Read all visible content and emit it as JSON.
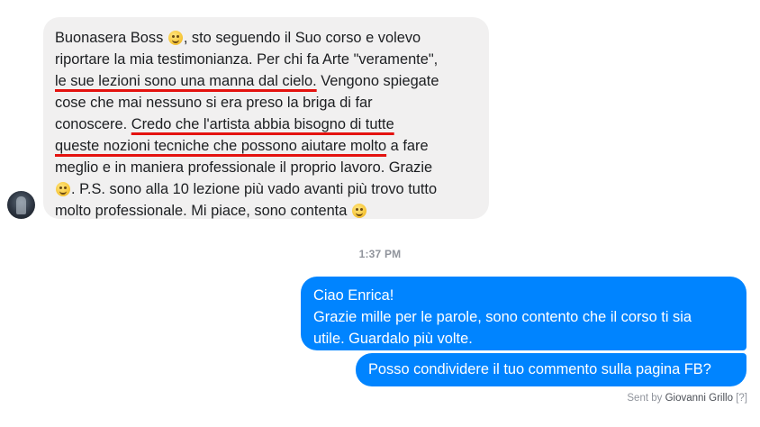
{
  "incoming": {
    "lines": [
      {
        "parts": [
          {
            "text": "Buonasera Boss "
          },
          {
            "emoji": "smiling-face-icon"
          },
          {
            "text": ", sto seguendo il Suo corso e volevo"
          }
        ]
      },
      {
        "parts": [
          {
            "text": "riportare la mia testimonianza. Per chi fa Arte \"veramente\","
          }
        ]
      },
      {
        "parts": [
          {
            "text": "le sue lezioni sono una manna dal cielo.",
            "u": true
          },
          {
            "text": " Vengono spiegate"
          }
        ]
      },
      {
        "parts": [
          {
            "text": "cose che mai nessuno si era preso la briga di far"
          }
        ]
      },
      {
        "parts": [
          {
            "text": "conoscere. "
          },
          {
            "text": "Credo che l'artista abbia bisogno di tutte",
            "u": true
          }
        ]
      },
      {
        "parts": [
          {
            "text": "queste nozioni tecniche che possono aiutare molto",
            "u": true
          },
          {
            "text": " a fare"
          }
        ]
      },
      {
        "parts": [
          {
            "text": "meglio e in maniera professionale il proprio lavoro. Grazie"
          }
        ]
      },
      {
        "parts": [
          {
            "emoji": "smiling-face-icon"
          },
          {
            "text": ". P.S. sono alla 10 lezione più vado avanti più trovo tutto"
          }
        ]
      },
      {
        "parts": [
          {
            "text": "molto professionale. Mi piace, sono contenta "
          },
          {
            "emoji": "winking-face-icon"
          }
        ]
      }
    ]
  },
  "timestamp": "1:37 PM",
  "outgoing": {
    "bubble1": [
      "Ciao Enrica!",
      "Grazie mille per le parole, sono contento che il corso ti sia",
      "utile. Guardalo più volte."
    ],
    "bubble2": "Posso condividere il tuo commento sulla pagina FB?"
  },
  "sent_by": {
    "prefix": "Sent by",
    "name": "Giovanni Grillo",
    "help": "[?]"
  },
  "colors": {
    "outgoing_bubble": "#0084ff",
    "incoming_bubble": "#f1f0f0",
    "underline": "#e4120f"
  }
}
